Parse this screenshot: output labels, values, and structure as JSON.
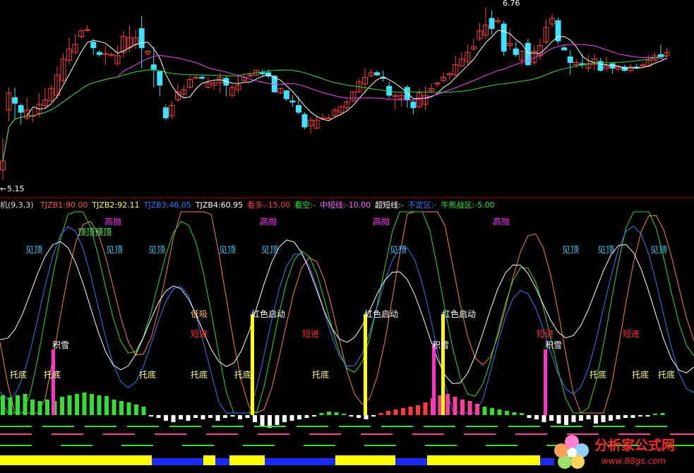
{
  "colors": {
    "bg": "#000000",
    "up": "#ff3b3b",
    "down": "#40e0ff",
    "ma1": "#ffffff",
    "ma2": "#ff40ff",
    "ma3": "#33dd33",
    "axis": "#aa0000"
  },
  "price_panel": {
    "high_label": "6.76",
    "low_label": "5.15"
  },
  "indicator_header": {
    "name": "机(9,3,3)",
    "items": [
      {
        "label": "TJZB1:90.00",
        "color": "#ff5555"
      },
      {
        "label": "TJZB2:92.11",
        "color": "#ffff55"
      },
      {
        "label": "TJZB3:46.05",
        "color": "#3a7bff"
      },
      {
        "label": "TJZB4:60.95",
        "color": "#ffffff"
      },
      {
        "label": "看多:-15.00",
        "color": "#ff4444"
      },
      {
        "label": "看空:-",
        "color": "#33ee33"
      },
      {
        "label": "中短线:-10.00",
        "color": "#ff66ff"
      },
      {
        "label": "超短线:-",
        "color": "#ffffff"
      },
      {
        "label": "不定区:-",
        "color": "#3a7bff"
      },
      {
        "label": "牛熊战区:-5.00",
        "color": "#33ee33"
      }
    ]
  },
  "chart_data": [
    {
      "type": "candlestick",
      "title": "",
      "ylim": [
        5.15,
        6.76
      ],
      "annotations": [
        "6.76",
        "5.15"
      ],
      "candles": [
        [
          5.32,
          5.4,
          5.23,
          5.6
        ],
        [
          5.85,
          6.0,
          5.75,
          6.05
        ],
        [
          5.96,
          5.91,
          5.77,
          6.05
        ],
        [
          5.89,
          5.83,
          5.72,
          5.91
        ],
        [
          5.78,
          5.85,
          5.76,
          5.96
        ],
        [
          5.8,
          5.8,
          5.74,
          5.86
        ],
        [
          5.82,
          5.9,
          5.79,
          6.0
        ],
        [
          5.89,
          5.94,
          5.87,
          6.05
        ],
        [
          5.93,
          6.04,
          5.92,
          6.07
        ],
        [
          5.98,
          6.16,
          5.95,
          6.24
        ],
        [
          6.11,
          6.3,
          6.09,
          6.35
        ],
        [
          6.29,
          6.39,
          6.25,
          6.49
        ],
        [
          6.36,
          6.43,
          6.34,
          6.52
        ],
        [
          6.5,
          6.55,
          6.48,
          6.57
        ],
        [
          6.56,
          6.56,
          6.54,
          6.6
        ],
        [
          6.45,
          6.4,
          6.34,
          6.48
        ],
        [
          6.36,
          6.34,
          6.32,
          6.38
        ],
        [
          6.34,
          6.35,
          6.25,
          6.42
        ],
        [
          6.33,
          6.34,
          6.32,
          6.36
        ],
        [
          6.26,
          6.33,
          6.24,
          6.42
        ],
        [
          6.36,
          6.5,
          6.31,
          6.55
        ],
        [
          6.4,
          6.49,
          6.36,
          6.6
        ],
        [
          6.43,
          6.49,
          6.39,
          6.56
        ],
        [
          6.57,
          6.4,
          6.22,
          6.68
        ],
        [
          6.35,
          6.37,
          6.33,
          6.38
        ],
        [
          6.25,
          6.21,
          6.05,
          6.41
        ],
        [
          6.19,
          6.07,
          5.97,
          6.19
        ],
        [
          5.87,
          5.78,
          5.76,
          5.9
        ],
        [
          5.8,
          5.89,
          5.77,
          5.93
        ],
        [
          5.94,
          6.01,
          5.92,
          6.08
        ],
        [
          5.99,
          6.03,
          5.96,
          6.07
        ],
        [
          6.05,
          6.12,
          6.04,
          6.16
        ],
        [
          6.13,
          6.14,
          6.12,
          6.16
        ],
        [
          6.14,
          6.13,
          6.12,
          6.16
        ],
        [
          6.05,
          6.09,
          6.04,
          6.14
        ],
        [
          6.07,
          6.09,
          6.03,
          6.11
        ],
        [
          6.09,
          6.14,
          6.0,
          6.18
        ],
        [
          6.13,
          6.07,
          5.97,
          6.15
        ],
        [
          5.98,
          6.05,
          5.96,
          6.08
        ],
        [
          6.03,
          6.07,
          6.0,
          6.15
        ],
        [
          6.11,
          6.14,
          6.1,
          6.17
        ],
        [
          6.15,
          6.16,
          6.14,
          6.18
        ],
        [
          6.16,
          6.2,
          6.15,
          6.21
        ],
        [
          6.18,
          6.17,
          6.15,
          6.21
        ],
        [
          6.18,
          6.15,
          6.13,
          6.21
        ],
        [
          6.15,
          6.01,
          6.0,
          6.16
        ],
        [
          6.0,
          6.04,
          5.99,
          6.05
        ],
        [
          6.02,
          5.95,
          5.93,
          6.03
        ],
        [
          5.93,
          5.92,
          5.88,
          5.98
        ],
        [
          5.89,
          5.83,
          5.81,
          5.97
        ],
        [
          5.81,
          5.7,
          5.68,
          5.83
        ],
        [
          5.71,
          5.76,
          5.64,
          5.79
        ],
        [
          5.69,
          5.76,
          5.68,
          5.8
        ],
        [
          5.78,
          5.78,
          5.77,
          5.82
        ],
        [
          5.78,
          5.78,
          5.77,
          5.81
        ],
        [
          5.8,
          5.85,
          5.79,
          5.87
        ],
        [
          5.83,
          5.88,
          5.8,
          5.89
        ],
        [
          5.87,
          5.92,
          5.85,
          5.95
        ],
        [
          5.93,
          6.01,
          5.92,
          6.02
        ],
        [
          6.01,
          6.1,
          6.0,
          6.13
        ],
        [
          6.08,
          6.14,
          6.0,
          6.22
        ],
        [
          6.15,
          6.18,
          6.14,
          6.21
        ],
        [
          6.18,
          6.16,
          6.15,
          6.2
        ],
        [
          6.14,
          6.13,
          6.1,
          6.2
        ],
        [
          6.06,
          5.98,
          5.96,
          6.1
        ],
        [
          5.97,
          5.98,
          5.85,
          6.0
        ],
        [
          5.95,
          5.98,
          5.88,
          6.0
        ],
        [
          6.05,
          5.94,
          5.87,
          6.07
        ],
        [
          5.92,
          5.87,
          5.81,
          5.93
        ],
        [
          5.88,
          6.0,
          5.86,
          6.04
        ],
        [
          5.9,
          5.98,
          5.85,
          6.06
        ],
        [
          6.02,
          6.04,
          6.0,
          6.09
        ],
        [
          6.08,
          6.09,
          6.06,
          6.1
        ],
        [
          6.11,
          6.14,
          6.09,
          6.18
        ],
        [
          6.16,
          6.17,
          6.12,
          6.19
        ],
        [
          6.16,
          6.25,
          6.15,
          6.33
        ],
        [
          6.24,
          6.3,
          6.23,
          6.36
        ],
        [
          6.28,
          6.36,
          6.24,
          6.43
        ],
        [
          6.39,
          6.41,
          6.37,
          6.48
        ],
        [
          6.48,
          6.55,
          6.46,
          6.62
        ],
        [
          6.51,
          6.6,
          6.48,
          6.76
        ],
        [
          6.66,
          6.57,
          6.52,
          6.73
        ],
        [
          6.63,
          6.64,
          6.61,
          6.67
        ],
        [
          6.61,
          6.37,
          6.33,
          6.64
        ],
        [
          6.42,
          6.44,
          6.38,
          6.57
        ],
        [
          6.39,
          6.34,
          6.32,
          6.45
        ],
        [
          6.29,
          6.37,
          6.25,
          6.38
        ],
        [
          6.44,
          6.25,
          6.24,
          6.48
        ],
        [
          6.27,
          6.37,
          6.25,
          6.42
        ],
        [
          6.33,
          6.42,
          6.29,
          6.48
        ],
        [
          6.45,
          6.58,
          6.43,
          6.65
        ],
        [
          6.61,
          6.66,
          6.58,
          6.7
        ],
        [
          6.64,
          6.46,
          6.43,
          6.67
        ],
        [
          6.4,
          6.38,
          6.38,
          6.42
        ],
        [
          6.32,
          6.27,
          6.16,
          6.38
        ],
        [
          6.25,
          6.27,
          6.22,
          6.3
        ],
        [
          6.26,
          6.25,
          6.22,
          6.35
        ],
        [
          6.22,
          6.26,
          6.19,
          6.34
        ],
        [
          6.25,
          6.3,
          6.2,
          6.35
        ],
        [
          6.28,
          6.2,
          6.19,
          6.31
        ],
        [
          6.22,
          6.24,
          6.19,
          6.32
        ],
        [
          6.26,
          6.22,
          6.17,
          6.26
        ],
        [
          6.21,
          6.23,
          6.19,
          6.24
        ],
        [
          6.23,
          6.2,
          6.19,
          6.25
        ],
        [
          6.2,
          6.23,
          6.18,
          6.26
        ],
        [
          6.23,
          6.22,
          6.21,
          6.26
        ],
        [
          6.24,
          6.25,
          6.23,
          6.27
        ],
        [
          6.24,
          6.29,
          6.23,
          6.34
        ],
        [
          6.29,
          6.33,
          6.28,
          6.36
        ],
        [
          6.34,
          6.32,
          6.3,
          6.43
        ],
        [
          6.33,
          6.36,
          6.31,
          6.4
        ]
      ]
    },
    {
      "type": "bar",
      "title": "",
      "series": [
        {
          "values": [
            28,
            25,
            28,
            30,
            22,
            20,
            22,
            20,
            26,
            28,
            30,
            32,
            30,
            28,
            27,
            22,
            20,
            18,
            15,
            12,
            -1,
            -2,
            -4,
            -5,
            -3,
            -4,
            -2,
            -3,
            -2,
            -4,
            -2,
            -1,
            -3,
            -2,
            -5,
            -8,
            -9,
            -7,
            -5,
            -4,
            -3,
            -2,
            -1,
            3,
            5,
            4,
            2,
            -1,
            -2,
            -3,
            -1,
            3,
            6,
            8,
            10,
            12,
            14,
            18,
            24,
            28,
            30,
            26,
            22,
            20,
            16,
            12,
            10,
            8,
            6,
            4,
            3,
            -2,
            -3,
            -5,
            -4,
            -6,
            -7,
            -5,
            -4,
            -3,
            -6,
            -5,
            -4,
            -3,
            -2,
            -2,
            -1,
            -1,
            2,
            3
          ]
        }
      ]
    }
  ],
  "labels": {
    "jianding": "见顶",
    "gaopao": "高抛",
    "dingding": "顶顶预顶",
    "dixi": "低吸",
    "duanjin": "短进",
    "jixue": "积雪",
    "tuodi": "托底",
    "qidong": "红色启动"
  },
  "watermark": {
    "title": "分析家公式网",
    "url": "www.88gs.com"
  }
}
